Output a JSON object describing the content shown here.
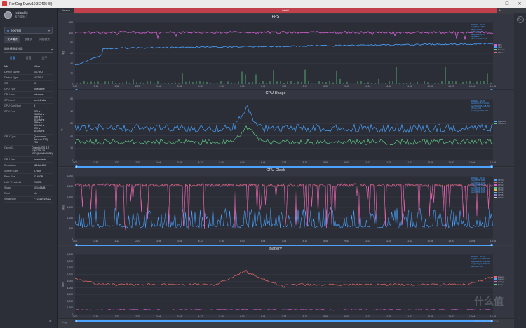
{
  "window": {
    "title": "PerfDog Evolv10.3.240548)"
  },
  "user": {
    "name": "red Selfie",
    "subtitle": "客户端版 ⇩"
  },
  "device": {
    "name": "NX769J"
  },
  "mode_tabs": [
    "安卓模式",
    "多模式",
    "网络模式"
  ],
  "app_select": {
    "label": "请选择测试应用"
  },
  "info_tabs": [
    "设备",
    "设置",
    "关于"
  ],
  "info": {
    "header": {
      "key": "Info",
      "value": "Value"
    },
    "rows": [
      {
        "key": "Device Name",
        "value": "NX769J"
      },
      {
        "key": "Device Type",
        "value": "NX769J"
      },
      {
        "key": "OS",
        "value": "15"
      },
      {
        "key": "CPU Type",
        "value": "pineapple"
      },
      {
        "key": "CPU Info",
        "value": "unknown"
      },
      {
        "key": "CPU Arch",
        "value": "arm64-v8a"
      },
      {
        "key": "CPU CoreNum",
        "value": "8"
      },
      {
        "key": "CPU Freq",
        "value": "0MHz ~ 2265MHz\n0MHz ~ 3014MHz\n0MHz ~ 3014MHz\n0MHz ~ 3014MHz"
      },
      {
        "key": "GPU Type",
        "value": "Qualcomm Adreno (TM) 750"
      },
      {
        "key": "OpenGL",
        "value": "OpenGL ES 3.2\nV@0746.19\n(GIT@d6e2d3502)"
      },
      {
        "key": "GPU Freq",
        "value": "unavailable"
      },
      {
        "key": "Resolution",
        "value": "1116x2480"
      },
      {
        "key": "Screen Size",
        "value": "6.78 in"
      },
      {
        "key": "Ram Size",
        "value": "23.6 GB"
      },
      {
        "key": "LMK Threshold",
        "value": "216MB"
      },
      {
        "key": "Swap",
        "value": "19144 MB"
      },
      {
        "key": "Root",
        "value": "No"
      },
      {
        "key": "SerialNum",
        "value": "FY241191901A"
      }
    ]
  },
  "tabs": {
    "left": "Session",
    "active": "label1"
  },
  "x_ticks": [
    "0:00",
    "0:44",
    "1:32",
    "2:20",
    "3:04",
    "3:48",
    "4:32",
    "5:16",
    "6:00",
    "6:44",
    "7:28",
    "8:12",
    "8:56",
    "9:40",
    "10:24",
    "11:08",
    "11:52",
    "12:36",
    "13:20",
    "14:04",
    "15:18"
  ],
  "panels": [
    {
      "id": "fps",
      "title": "FPS",
      "unit": "FPS",
      "yticks": [
        "120",
        "100",
        "80",
        "60",
        "40",
        "20",
        "0"
      ],
      "legend": [
        {
          "label": "FPS",
          "color": "#d95fd5"
        },
        {
          "label": "Jank",
          "color": "#4ba3ff"
        },
        {
          "label": "Smooth",
          "color": "#5fc985"
        },
        {
          "label": "FTime",
          "color": "#e86a6a"
        }
      ],
      "tooltip": [
        "00:00:18 - 01:53",
        "Avg(FPS):116.5",
        "Var(FPS):0.0",
        "Drop(FPS):0.0",
        "Jank(/10min):8.1",
        "BigJank:0",
        "FTime>=100ms:0%"
      ]
    },
    {
      "id": "cpu",
      "title": "CPU Usage",
      "unit": "%",
      "yticks": [
        "50",
        "40",
        "30",
        "20",
        "10",
        "0"
      ],
      "legend": [
        {
          "label": "AppCPU",
          "color": "#4ba3ff"
        },
        {
          "label": "TotalCPU",
          "color": "#5fc985"
        }
      ],
      "tooltip": [
        "00:00:18 - 01:53",
        "Avg(AppCPU):18.1%",
        "Avg(TotalCPU):28.3%",
        "CTemp:42.0",
        "Peak(AppCPU):37%"
      ]
    },
    {
      "id": "clock",
      "title": "CPU Clock",
      "unit": "MHz",
      "yticks": [
        "3,000",
        "2,500",
        "2,000",
        "1,500",
        "1,000",
        "500",
        "0"
      ],
      "legend": [
        {
          "label": "CPU0",
          "color": "#4ba3ff"
        },
        {
          "label": "CPU1",
          "color": "#e86a6a"
        },
        {
          "label": "CPU2",
          "color": "#d95fd5"
        },
        {
          "label": "CPU3",
          "color": "#5fc985"
        },
        {
          "label": "CPU4",
          "color": "#f0b54a"
        },
        {
          "label": "CPU5",
          "color": "#59c7d9"
        },
        {
          "label": "CPU6",
          "color": "#9d7bf0"
        },
        {
          "label": "CPU7",
          "color": "#c9c9c9"
        }
      ],
      "tooltip": [
        "00:00:18 - 01:53",
        "Avg(CPU0):1082",
        "Avg(CPU1):1935",
        "Avg(CPU2):1935",
        "Avg(CPU3):1935",
        "Avg(CPU4):1935",
        "Avg(CPU5):1935"
      ]
    },
    {
      "id": "battery",
      "title": "Battery",
      "unit": "mW",
      "yticks": [
        "9,000",
        "8,000",
        "7,000",
        "6,000",
        "5,000",
        "4,000",
        "3,000",
        "2,000",
        "1,000",
        "0"
      ],
      "legend": [
        {
          "label": "Power",
          "color": "#e86a6a"
        },
        {
          "label": "Current",
          "color": "#4ba3ff"
        },
        {
          "label": "Voltage",
          "color": "#d95fd5"
        },
        {
          "label": "Temp",
          "color": "#5fc985"
        }
      ],
      "tooltip": [
        "00:00:18 - 01:53",
        "Avg(Power):4200mW",
        "Avg(Current):1052mA",
        "Avg(Voltage):3980mV",
        "BattTemp:36.0"
      ]
    }
  ],
  "colors": {
    "accent": "#4ba3ff",
    "active_tab": "#c0404c",
    "fps": "#d95fd5",
    "jank": "#4ba3ff",
    "green": "#5fc985",
    "red": "#e86a6a"
  },
  "log_button": "Log",
  "watermark": {
    "mark": "什么值",
    "url": "www.smzdm.com"
  }
}
